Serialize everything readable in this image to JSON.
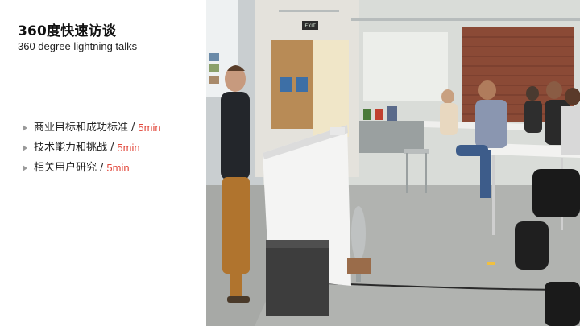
{
  "slide": {
    "title_cn": "360度快速访谈",
    "title_en": "360 degree lightning talks",
    "items": [
      {
        "label": "商业目标和成功标准",
        "sep": "/",
        "duration": "5min"
      },
      {
        "label": "技术能力和挑战",
        "sep": "/",
        "duration": "5min"
      },
      {
        "label": "相关用户研究",
        "sep": "/",
        "duration": "5min"
      }
    ],
    "photo": {
      "exit_sign": "EXIT"
    }
  },
  "colors": {
    "accent": "#e2473b",
    "bullet": "#9a9a9a",
    "text": "#222222"
  }
}
